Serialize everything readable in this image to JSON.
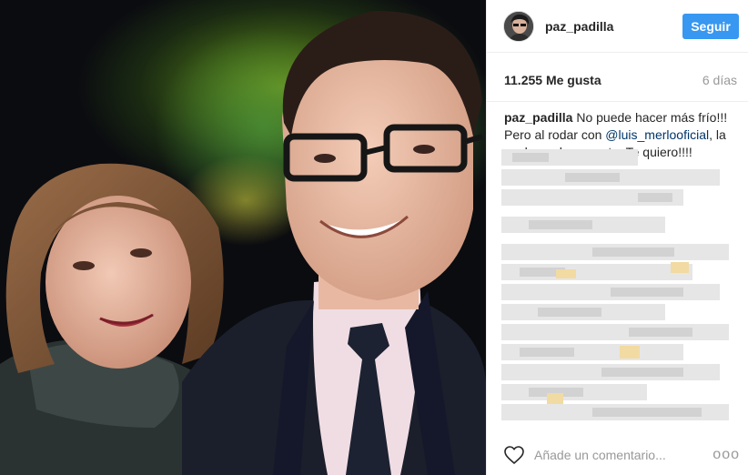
{
  "post": {
    "header": {
      "username": "paz_padilla",
      "follow_label": "Seguir"
    },
    "stats": {
      "likes": "11.255 Me gusta",
      "age": "6 días"
    },
    "caption": {
      "username": "paz_padilla",
      "text_1": " No puede hacer más frío!!! Pero al rodar con ",
      "mention": "@luis_merlooficial",
      "text_2": ", la noche se hace corta. Te quiero!!!!"
    },
    "comment_box": {
      "placeholder": "Añade un comentario..."
    },
    "more_label": "ooo"
  },
  "colors": {
    "accent": "#3897f0",
    "mention": "#003569",
    "muted": "#999999"
  },
  "icons": {
    "like": "heart-icon",
    "more": "more-options-icon"
  }
}
